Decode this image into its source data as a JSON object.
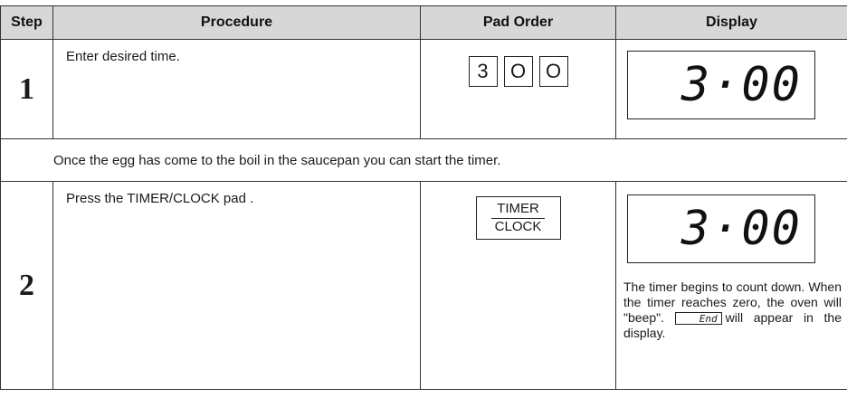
{
  "headers": {
    "step": "Step",
    "procedure": "Procedure",
    "pad_order": "Pad Order",
    "display": "Display"
  },
  "step1": {
    "number": "1",
    "procedure": "Enter desired time.",
    "keys": [
      "3",
      "O",
      "O"
    ],
    "display": "3·00"
  },
  "info_row": "Once the egg has come to the boil in the saucepan you can start the timer.",
  "step2": {
    "number": "2",
    "procedure": "Press the TIMER/CLOCK pad .",
    "pad_top": "TIMER",
    "pad_bottom": "CLOCK",
    "display": "3·00",
    "note_main": "The timer begins to count down. When the timer reaches zero, the oven will \"beep\".",
    "end_label": "End",
    "note_tail": "will appear in the display."
  }
}
